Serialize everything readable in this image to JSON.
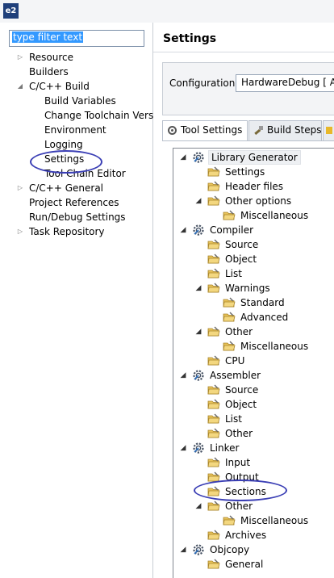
{
  "titlebar": {
    "logo": "e2",
    "logo_icon": "e2-studio-logo-icon"
  },
  "filter": {
    "placeholder": "type filter text"
  },
  "nav": [
    {
      "label": "Resource",
      "expander": "collapsed"
    },
    {
      "label": "Builders",
      "expander": "none"
    },
    {
      "label": "C/C++ Build",
      "expander": "expanded"
    },
    {
      "label": "Build Variables",
      "expander": "none"
    },
    {
      "label": "Change Toolchain Vers",
      "expander": "none"
    },
    {
      "label": "Environment",
      "expander": "none"
    },
    {
      "label": "Logging",
      "expander": "none"
    },
    {
      "label": "Settings",
      "expander": "none",
      "selected": true
    },
    {
      "label": "Tool Chain Editor",
      "expander": "none"
    },
    {
      "label": "C/C++ General",
      "expander": "collapsed"
    },
    {
      "label": "Project References",
      "expander": "none"
    },
    {
      "label": "Run/Debug Settings",
      "expander": "none"
    },
    {
      "label": "Task Repository",
      "expander": "collapsed"
    }
  ],
  "page": {
    "title": "Settings",
    "configuration_label": "Configuration:",
    "configuration_value": "HardwareDebug  [ Act"
  },
  "tabs": [
    {
      "label": "Tool Settings",
      "icon": "tool-settings-icon",
      "active": true
    },
    {
      "label": "Build Steps",
      "icon": "build-steps-icon",
      "active": false
    },
    {
      "label": "",
      "icon": "build-artifact-icon",
      "active": false
    }
  ],
  "tree": [
    {
      "label": "Library Generator",
      "icon": "gear",
      "expander": "expanded",
      "highlight": true
    },
    {
      "label": "Settings",
      "icon": "folder",
      "expander": "none"
    },
    {
      "label": "Header files",
      "icon": "folder",
      "expander": "none"
    },
    {
      "label": "Other options",
      "icon": "folder",
      "expander": "expanded"
    },
    {
      "label": "Miscellaneous",
      "icon": "folder",
      "expander": "none"
    },
    {
      "label": "Compiler",
      "icon": "gear",
      "expander": "expanded"
    },
    {
      "label": "Source",
      "icon": "folder",
      "expander": "none"
    },
    {
      "label": "Object",
      "icon": "folder",
      "expander": "none"
    },
    {
      "label": "List",
      "icon": "folder",
      "expander": "none"
    },
    {
      "label": "Warnings",
      "icon": "folder",
      "expander": "expanded"
    },
    {
      "label": "Standard",
      "icon": "folder",
      "expander": "none"
    },
    {
      "label": "Advanced",
      "icon": "folder",
      "expander": "none"
    },
    {
      "label": "Other",
      "icon": "folder",
      "expander": "expanded"
    },
    {
      "label": "Miscellaneous",
      "icon": "folder",
      "expander": "none"
    },
    {
      "label": "CPU",
      "icon": "folder",
      "expander": "none"
    },
    {
      "label": "Assembler",
      "icon": "gear",
      "expander": "expanded"
    },
    {
      "label": "Source",
      "icon": "folder",
      "expander": "none"
    },
    {
      "label": "Object",
      "icon": "folder",
      "expander": "none"
    },
    {
      "label": "List",
      "icon": "folder",
      "expander": "none"
    },
    {
      "label": "Other",
      "icon": "folder",
      "expander": "none"
    },
    {
      "label": "Linker",
      "icon": "gear",
      "expander": "expanded"
    },
    {
      "label": "Input",
      "icon": "folder",
      "expander": "none"
    },
    {
      "label": "Output",
      "icon": "folder",
      "expander": "none"
    },
    {
      "label": "Sections",
      "icon": "folder",
      "expander": "none",
      "selected": true
    },
    {
      "label": "Other",
      "icon": "folder",
      "expander": "expanded"
    },
    {
      "label": "Miscellaneous",
      "icon": "folder",
      "expander": "none"
    },
    {
      "label": "Archives",
      "icon": "folder",
      "expander": "none"
    },
    {
      "label": "Objcopy",
      "icon": "gear",
      "expander": "expanded"
    },
    {
      "label": "General",
      "icon": "folder",
      "expander": "none"
    }
  ],
  "colors": {
    "annotation": "#3b3fb5",
    "selection": "#3399ff",
    "folder": "#e8c35a"
  }
}
